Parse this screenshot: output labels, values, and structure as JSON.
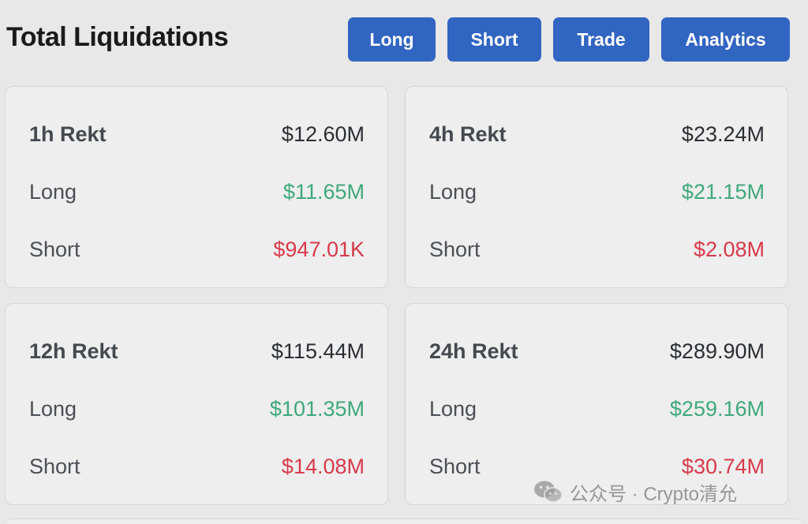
{
  "header": {
    "title": "Total Liquidations",
    "buttons": {
      "long": "Long",
      "short": "Short",
      "trade": "Trade",
      "analytics": "Analytics"
    }
  },
  "cards": [
    {
      "period": "1h Rekt",
      "total": "$12.60M",
      "long_label": "Long",
      "long_value": "$11.65M",
      "short_label": "Short",
      "short_value": "$947.01K"
    },
    {
      "period": "4h Rekt",
      "total": "$23.24M",
      "long_label": "Long",
      "long_value": "$21.15M",
      "short_label": "Short",
      "short_value": "$2.08M"
    },
    {
      "period": "12h Rekt",
      "total": "$115.44M",
      "long_label": "Long",
      "long_value": "$101.35M",
      "short_label": "Short",
      "short_value": "$14.08M"
    },
    {
      "period": "24h Rekt",
      "total": "$289.90M",
      "long_label": "Long",
      "long_value": "$259.16M",
      "short_label": "Short",
      "short_value": "$30.74M"
    }
  ],
  "watermark": {
    "text": "公众号 · Crypto清允",
    "icon": "wechat-icon"
  },
  "colors": {
    "button_bg": "#3165c2",
    "long_green": "#3fa87b",
    "short_red": "#d9394a",
    "page_bg": "#e8e8e8"
  }
}
